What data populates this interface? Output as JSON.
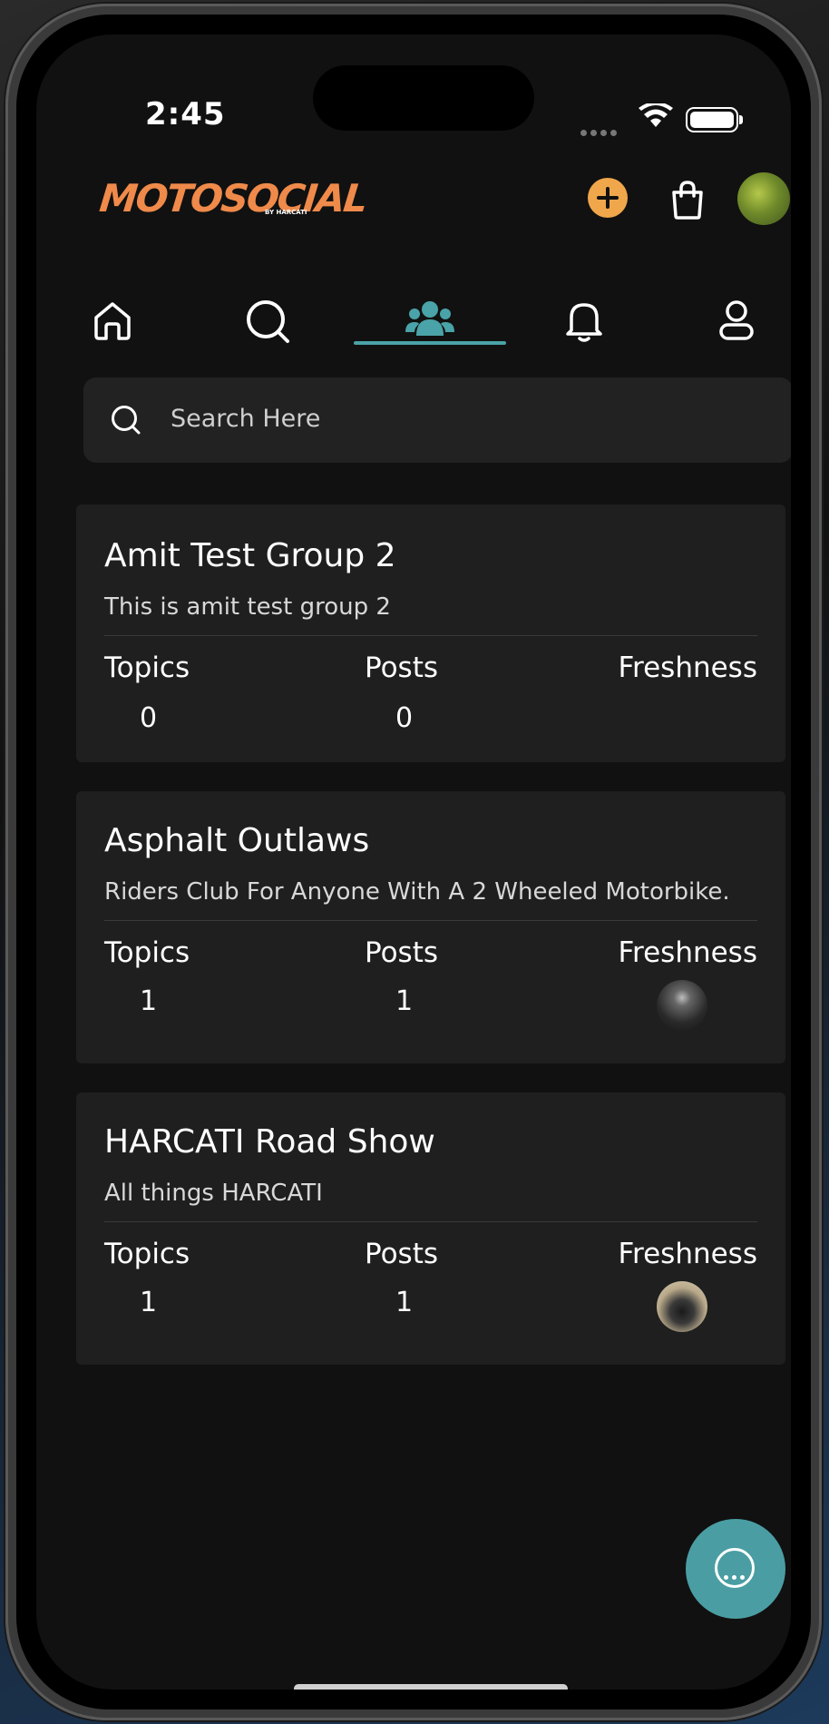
{
  "status_bar": {
    "time": "2:45"
  },
  "header": {
    "logo_text": "MOTOSOCIAL",
    "logo_sub": "BY HARCATI"
  },
  "nav": {
    "tabs": [
      {
        "label": "home",
        "icon": "home-icon"
      },
      {
        "label": "search",
        "icon": "search-icon"
      },
      {
        "label": "groups",
        "icon": "groups-icon",
        "active": true
      },
      {
        "label": "notifications",
        "icon": "bell-icon"
      },
      {
        "label": "profile",
        "icon": "user-icon"
      }
    ],
    "accent": "#4aa3a8"
  },
  "search": {
    "placeholder": "Search Here"
  },
  "groups": [
    {
      "title": "Amit Test Group 2",
      "description": "This is amit test group 2",
      "topics_label": "Topics",
      "posts_label": "Posts",
      "freshness_label": "Freshness",
      "topics": "0",
      "posts": "0"
    },
    {
      "title": "Asphalt Outlaws",
      "description": "Riders Club For Anyone With A 2 Wheeled Motorbike.",
      "topics_label": "Topics",
      "posts_label": "Posts",
      "freshness_label": "Freshness",
      "topics": "1",
      "posts": "1"
    },
    {
      "title": "HARCATI Road Show",
      "description": "All things HARCATI",
      "topics_label": "Topics",
      "posts_label": "Posts",
      "freshness_label": "Freshness",
      "topics": "1",
      "posts": "1"
    }
  ],
  "colors": {
    "background": "#111111",
    "card": "#1f1f1f",
    "brand": "#ef8a4a",
    "fab": "#4a9ea3"
  }
}
